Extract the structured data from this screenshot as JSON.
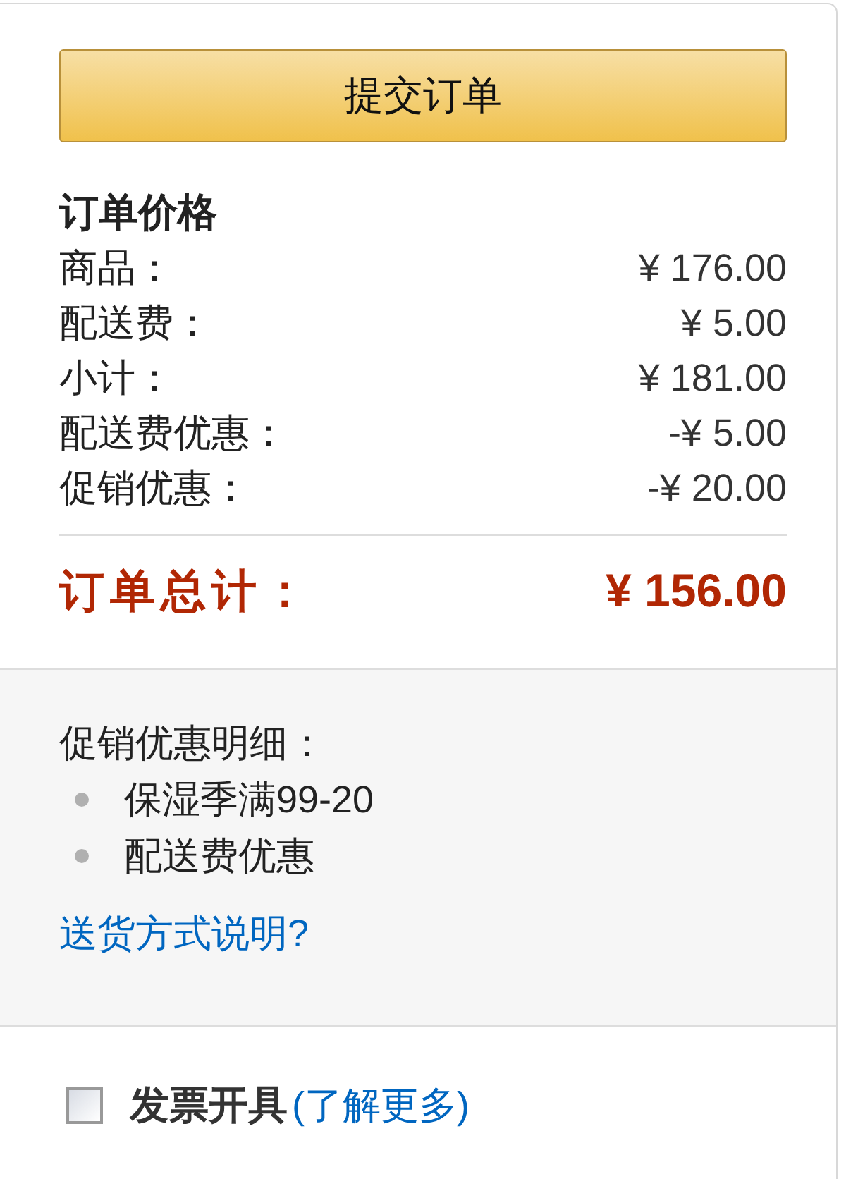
{
  "submit_button": {
    "label": "提交订单"
  },
  "price_summary": {
    "title": "订单价格",
    "rows": [
      {
        "label": "商品：",
        "value": "¥ 176.00"
      },
      {
        "label": "配送费：",
        "value": "¥ 5.00"
      },
      {
        "label": "小计：",
        "value": "¥ 181.00"
      },
      {
        "label": "配送费优惠：",
        "value": "-¥ 5.00"
      },
      {
        "label": "促销优惠：",
        "value": "-¥ 20.00"
      }
    ],
    "total": {
      "label": "订单总计：",
      "value": "¥ 156.00"
    }
  },
  "promotion_details": {
    "title": "促销优惠明细：",
    "items": [
      "保湿季满99-20",
      "配送费优惠"
    ],
    "link": "送货方式说明?"
  },
  "invoice": {
    "label": "发票开具",
    "checked": false,
    "link": "(了解更多)"
  }
}
